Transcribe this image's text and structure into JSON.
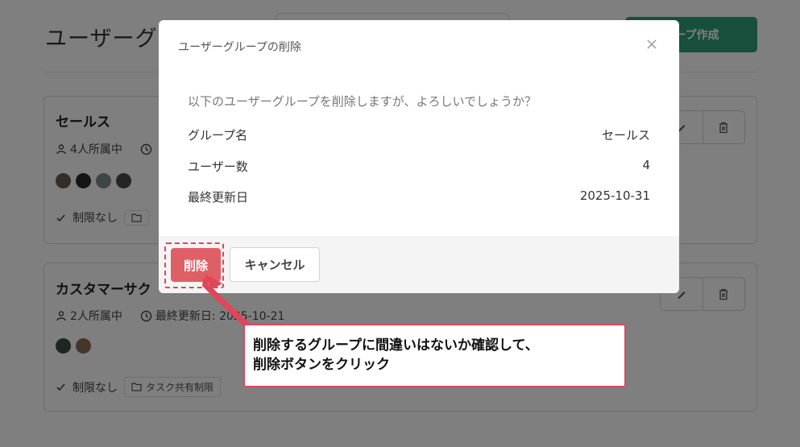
{
  "page": {
    "title": "ユーザーグル",
    "create_button_label": "ループ作成"
  },
  "cards": [
    {
      "name": "セールス",
      "member_text": "4人所属中",
      "updated_text": "",
      "restriction_label": "制限なし",
      "tag_label": ""
    },
    {
      "name": "カスタマーサク",
      "member_text": "2人所属中",
      "updated_text": "最終更新日: 2025-10-21",
      "restriction_label": "制限なし",
      "tag_label": "タスク共有制限"
    }
  ],
  "modal": {
    "title": "ユーザーグループの削除",
    "message": "以下のユーザーグループを削除しますが、よろしいでしょうか？",
    "rows": [
      {
        "label": "グループ名",
        "value": "セールス"
      },
      {
        "label": "ユーザー数",
        "value": "4"
      },
      {
        "label": "最終更新日",
        "value": "2025-10-31"
      }
    ],
    "delete_label": "削除",
    "cancel_label": "キャンセル"
  },
  "callout": {
    "text": "削除するグループに間違いはないか確認して、\n削除ボタンをクリック"
  },
  "colors": {
    "primary_green": "#2f9e79",
    "danger_red": "#df5f67",
    "callout_border": "#e0465a"
  },
  "icons": {
    "close": "close-icon",
    "edit": "pencil-icon",
    "delete": "trash-icon",
    "user": "user-icon",
    "clock": "clock-icon",
    "check": "check-icon",
    "folder": "folder-icon"
  }
}
